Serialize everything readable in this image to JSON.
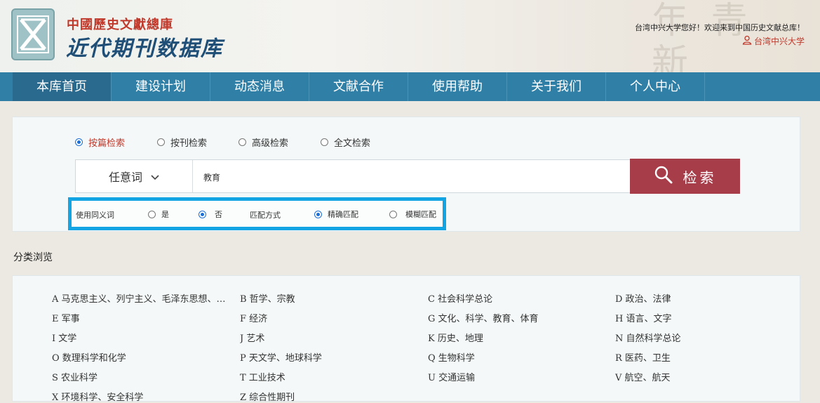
{
  "header": {
    "logo_line1": "中國歷史文獻總庫",
    "logo_line2": "近代期刊数据库",
    "background_text": "年 青 新",
    "welcome": "台湾中兴大学您好！欢迎来到中国历史文献总库！",
    "user_label": "台湾中兴大学"
  },
  "nav": {
    "items": [
      {
        "label": "本库首页"
      },
      {
        "label": "建设计划"
      },
      {
        "label": "动态消息"
      },
      {
        "label": "文献合作"
      },
      {
        "label": "使用帮助"
      },
      {
        "label": "关于我们"
      },
      {
        "label": "个人中心"
      }
    ]
  },
  "search": {
    "types": [
      {
        "label": "按篇检索",
        "selected": true
      },
      {
        "label": "按刊检索",
        "selected": false
      },
      {
        "label": "高级检索",
        "selected": false
      },
      {
        "label": "全文检索",
        "selected": false
      }
    ],
    "field": "任意词",
    "query": "教育",
    "button_label": "检索",
    "options": {
      "synonym_label": "使用同义词",
      "yes_label": "是",
      "no_label": "否",
      "synonym_selected": "否",
      "match_label": "匹配方式",
      "exact_label": "精确匹配",
      "fuzzy_label": "模糊匹配",
      "match_selected": "精确匹配"
    }
  },
  "browse": {
    "title": "分类浏览",
    "categories": [
      "A 马克思主义、列宁主义、毛泽东思想、邓小平理论",
      "B 哲学、宗教",
      "C 社会科学总论",
      "D 政治、法律",
      "E 军事",
      "F 经济",
      "G 文化、科学、教育、体育",
      "H 语言、文字",
      "I 文学",
      "J 艺术",
      "K 历史、地理",
      "N 自然科学总论",
      "O 数理科学和化学",
      "P 天文学、地球科学",
      "Q 生物科学",
      "R 医药、卫生",
      "S 农业科学",
      "T 工业技术",
      "U 交通运输",
      "V 航空、航天",
      "X 环境科学、安全科学",
      "Z 综合性期刊"
    ]
  },
  "colors": {
    "nav_bg": "#2f7fa6",
    "search_button": "#a83d4a",
    "highlight_border": "#13a4e3",
    "accent_red": "#c0392b"
  }
}
